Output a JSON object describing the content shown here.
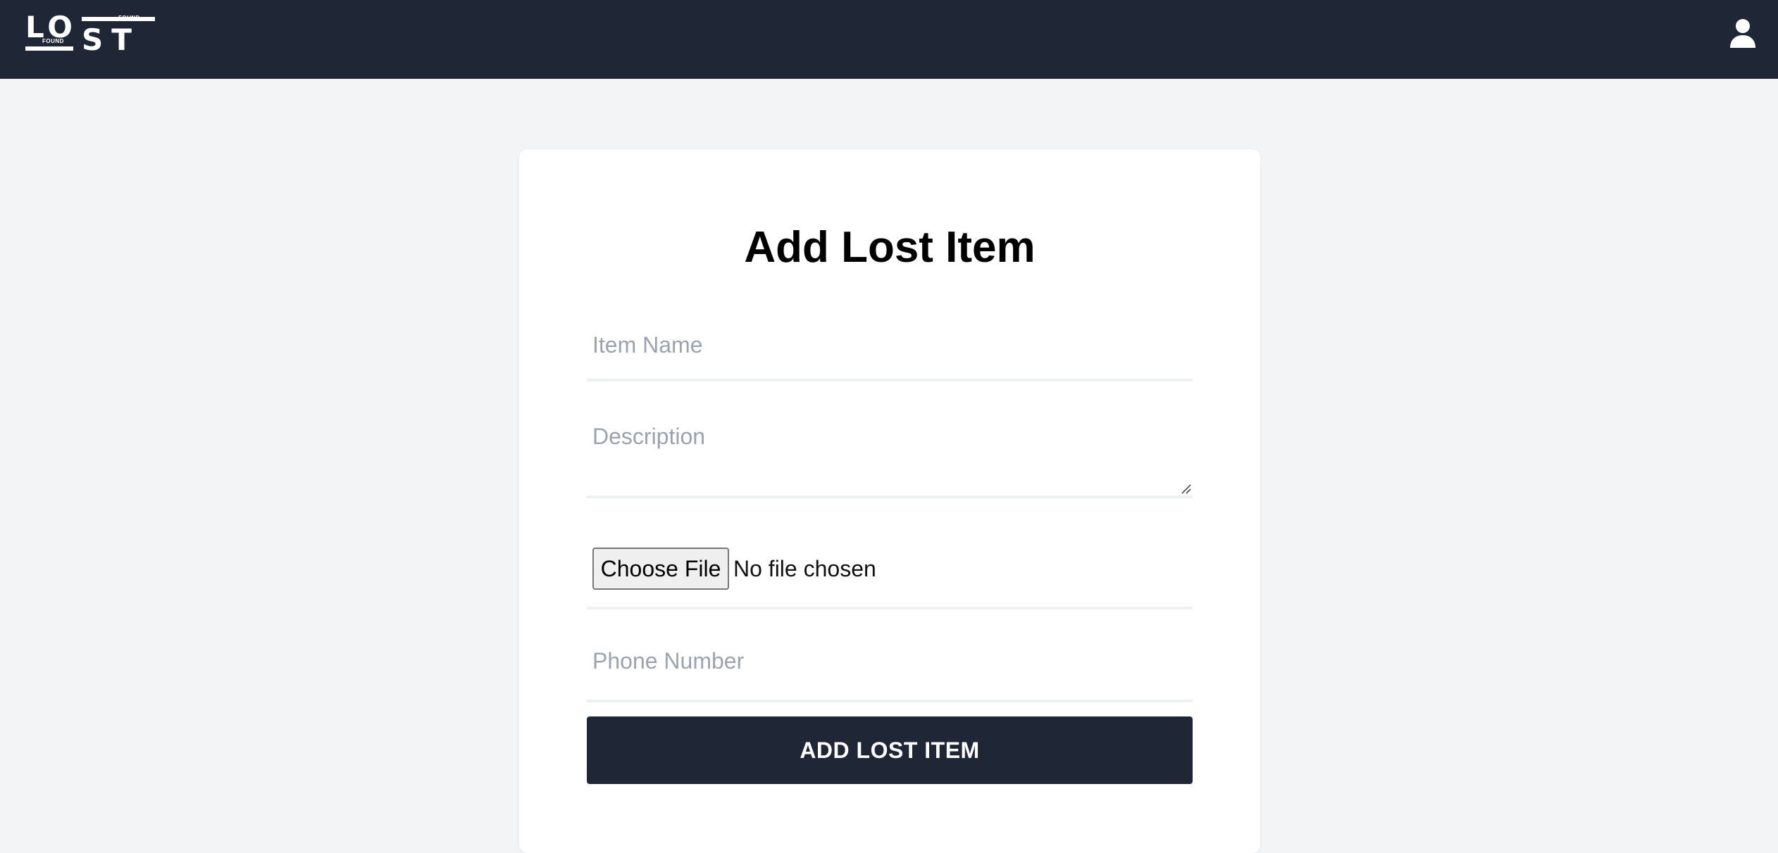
{
  "navbar": {
    "logo": {
      "main_top": "LO",
      "main_bottom": "ST",
      "small_top": "FOUND",
      "small_bottom": "FOUND"
    },
    "user_icon": "user-icon"
  },
  "form": {
    "title": "Add Lost Item",
    "item_name": {
      "placeholder": "Item Name",
      "value": ""
    },
    "description": {
      "placeholder": "Description",
      "value": ""
    },
    "file": {
      "button_label": "Choose File",
      "status": "No file chosen"
    },
    "phone": {
      "placeholder": "Phone Number",
      "value": ""
    },
    "submit_label": "ADD LOST ITEM"
  },
  "colors": {
    "navbar_bg": "#1f2737",
    "page_bg": "#f3f4f6",
    "card_bg": "#ffffff",
    "button_bg": "#1f2737",
    "placeholder": "#9ca3af"
  }
}
